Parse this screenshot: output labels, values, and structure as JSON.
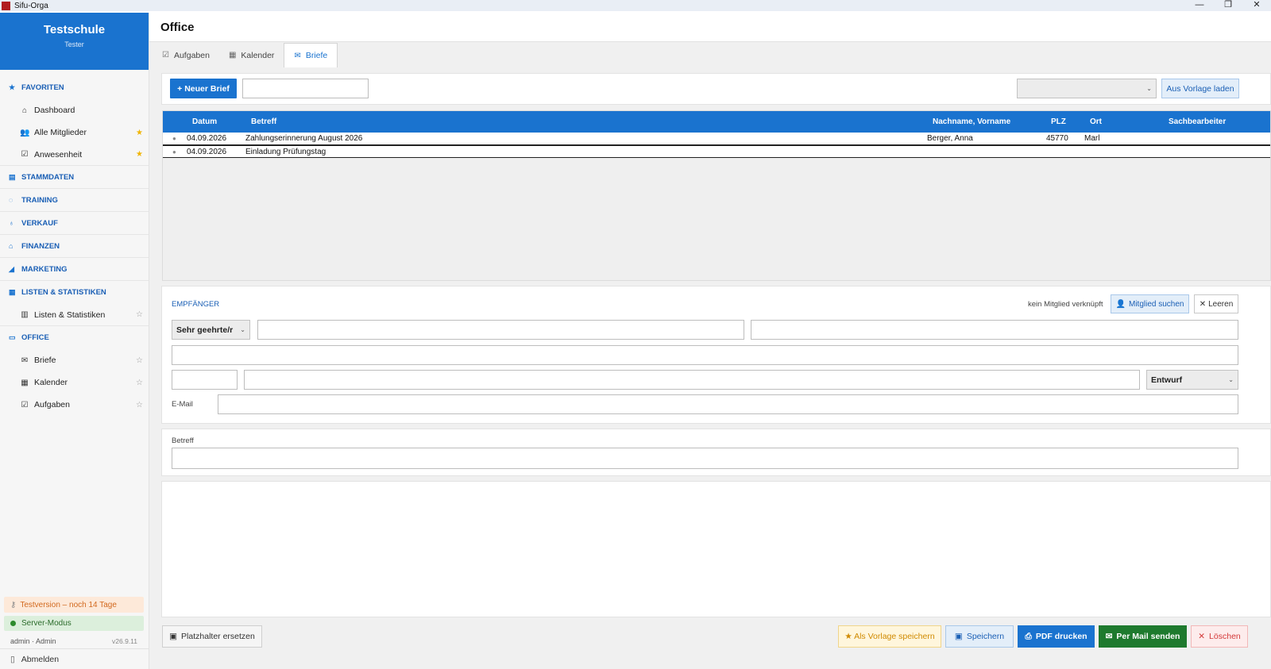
{
  "window": {
    "title": "Sifu-Orga",
    "minimize": "—",
    "restore": "❐",
    "close": "✕"
  },
  "sidebar": {
    "school": "Testschule",
    "user": "Tester",
    "favorites": {
      "label": "FAVORITEN",
      "items": [
        {
          "label": "Dashboard",
          "icon": "home-icon"
        },
        {
          "label": "Alle Mitglieder",
          "icon": "users-icon",
          "starred": true
        },
        {
          "label": "Anwesenheit",
          "icon": "checkbox-icon",
          "starred": true
        }
      ]
    },
    "sections": {
      "stammdaten": "STAMMDATEN",
      "training": "TRAINING",
      "verkauf": "VERKAUF",
      "finanzen": "FINANZEN",
      "marketing": "MARKETING",
      "listen": "LISTEN & STATISTIKEN",
      "office": "OFFICE"
    },
    "listen_items": [
      {
        "label": "Listen & Statistiken"
      }
    ],
    "office_items": [
      {
        "label": "Briefe"
      },
      {
        "label": "Kalender"
      },
      {
        "label": "Aufgaben"
      }
    ],
    "trial": "Testversion – noch 14 Tage",
    "server": "Server-Modus",
    "admin": "admin · Admin",
    "version": "v26.9.11",
    "logout": "Abmelden"
  },
  "header": {
    "title": "Office"
  },
  "tabs": [
    {
      "label": "Aufgaben",
      "icon": "checkbox-icon"
    },
    {
      "label": "Kalender",
      "icon": "calendar-icon"
    },
    {
      "label": "Briefe",
      "icon": "envelope-icon",
      "active": true
    }
  ],
  "toolbar": {
    "new_letter": "+ Neuer Brief",
    "search_value": "",
    "template_select": "",
    "load_template": "Aus Vorlage laden"
  },
  "table": {
    "columns": [
      "Datum",
      "Betreff",
      "Nachname, Vorname",
      "PLZ",
      "Ort",
      "Sachbearbeiter"
    ],
    "rows": [
      {
        "datum": "04.09.2026",
        "betreff": "Zahlungserinnerung August 2026",
        "name": "Berger, Anna",
        "plz": "45770",
        "ort": "Marl",
        "sachbearbeiter": ""
      },
      {
        "datum": "04.09.2026",
        "betreff": "Einladung Prüfungstag",
        "name": "",
        "plz": "",
        "ort": "",
        "sachbearbeiter": ""
      }
    ]
  },
  "recipient": {
    "heading": "EMPFÄNGER",
    "link_status": "kein Mitglied verknüpft",
    "search_member": "Mitglied suchen",
    "clear": "Leeren",
    "salutation": "Sehr geehrte/r",
    "status": "Entwurf",
    "email_label": "E-Mail"
  },
  "betreff": {
    "label": "Betreff",
    "value": ""
  },
  "bottom": {
    "placeholder": "Platzhalter ersetzen",
    "save_template": "★ Als Vorlage speichern",
    "save": "Speichern",
    "pdf": "PDF drucken",
    "mail": "Per Mail senden",
    "delete": "Löschen"
  },
  "colors": {
    "accent": "#1a73cf",
    "mail_btn": "#1e7a2e",
    "delete": "#d43a3a"
  }
}
